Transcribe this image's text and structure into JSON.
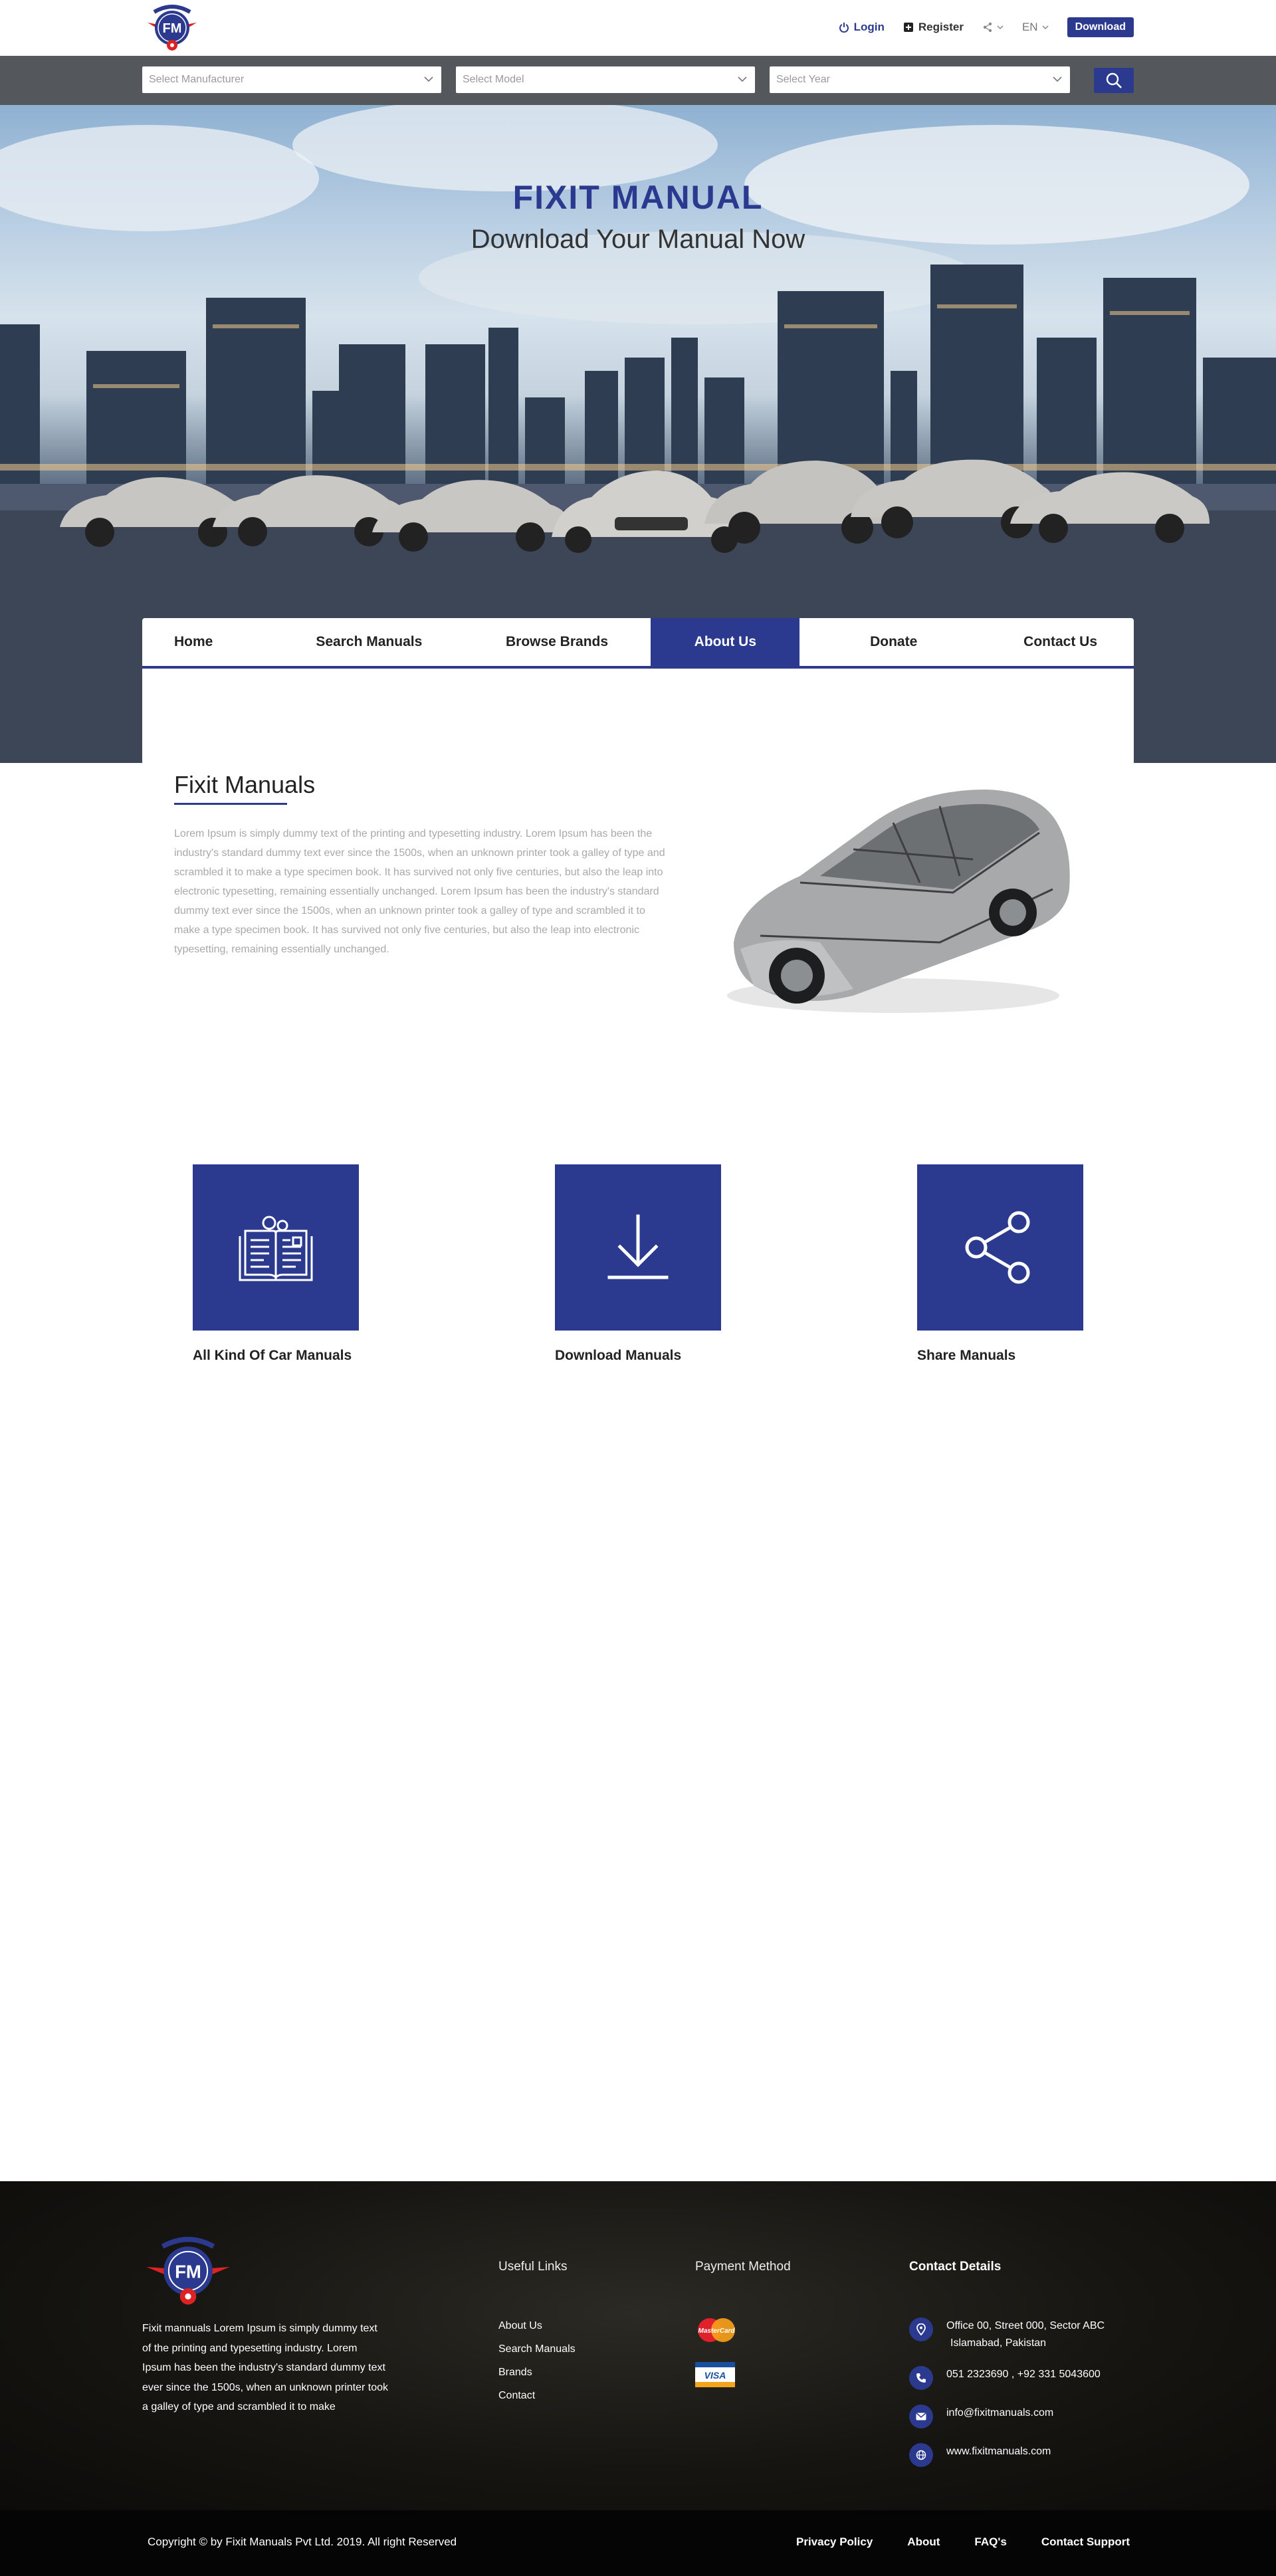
{
  "brand": {
    "logo_text": "FIXIT MANUAL",
    "logo_initials": "FM",
    "primary_color": "#2b3a8f"
  },
  "topbar": {
    "login": "Login",
    "register": "Register",
    "language": "EN",
    "download": "Download"
  },
  "search": {
    "manufacturer_placeholder": "Select Manufacturer",
    "model_placeholder": "Select Model",
    "year_placeholder": "Select Year"
  },
  "hero": {
    "title": "FIXIT MANUAL",
    "subtitle": "Download Your Manual Now"
  },
  "nav": {
    "items": [
      {
        "label": "Home"
      },
      {
        "label": "Search Manuals"
      },
      {
        "label": "Browse Brands"
      },
      {
        "label": "About Us",
        "active": true
      },
      {
        "label": "Donate"
      },
      {
        "label": "Contact Us"
      }
    ]
  },
  "about": {
    "title": "Fixit Manuals",
    "body": "Lorem Ipsum is simply dummy text of the printing and typesetting industry. Lorem Ipsum has been the industry's standard dummy text ever since the 1500s, when an unknown printer took a galley of type and scrambled it to make a type specimen book. It has survived not only five centuries, but also the leap into electronic typesetting, remaining essentially unchanged. Lorem Ipsum has been the industry's standard dummy text ever since the 1500s, when an unknown printer took a galley of type and scrambled it to make a type specimen book. It has survived not only five centuries, but also the leap into electronic typesetting, remaining essentially unchanged."
  },
  "features": [
    {
      "label": "All Kind Of Car Manuals",
      "icon": "manual-book-icon"
    },
    {
      "label": "Download Manuals",
      "icon": "download-icon"
    },
    {
      "label": "Share Manuals",
      "icon": "share-icon"
    }
  ],
  "footer": {
    "about": "Fixit mannuals Lorem Ipsum is simply dummy text of the printing and typesetting industry. Lorem Ipsum has been the industry's standard dummy text ever since the 1500s, when an unknown printer took a galley of type and scrambled it to make",
    "useful_links_title": "Useful Links",
    "useful_links": [
      "About Us",
      "Search Manuals",
      "Brands",
      "Contact"
    ],
    "payment_title": "Payment Method",
    "payment_methods": [
      "MasterCard",
      "VISA"
    ],
    "contact_title": "Contact Details",
    "address_line1": "Office 00, Street 000, Sector ABC",
    "address_line2": "Islamabad, Pakistan",
    "phone": "051 2323690 , +92 331 5043600",
    "email": "info@fixitmanuals.com",
    "website": "www.fixitmanuals.com"
  },
  "bottom": {
    "copyright": "Copyright © by Fixit Manuals Pvt Ltd. 2019. All right Reserved",
    "links": [
      "Privacy Policy",
      "About",
      "FAQ's",
      "Contact Support"
    ]
  }
}
